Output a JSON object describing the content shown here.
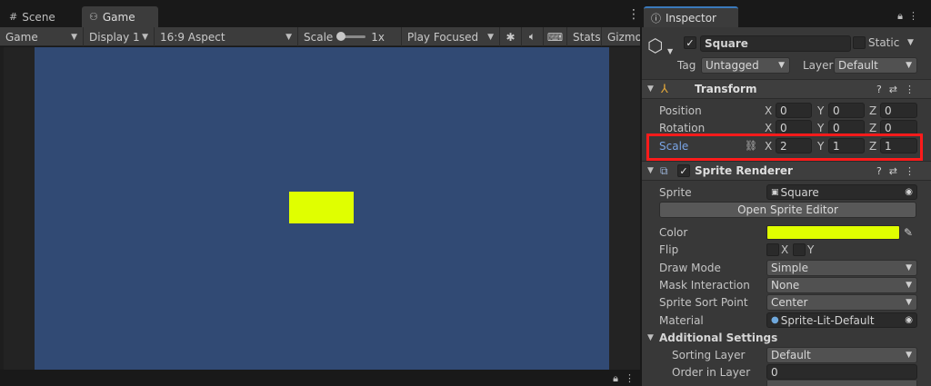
{
  "left": {
    "tabs": [
      {
        "label": "Scene",
        "icon": "grid-icon"
      },
      {
        "label": "Game",
        "icon": "gamepad-icon"
      }
    ],
    "toolbar": {
      "display_mode": "Game",
      "display": "Display 1",
      "aspect": "16:9 Aspect",
      "scale_label": "Scale",
      "scale_value": "1x",
      "play_mode": "Play Focused",
      "stats": "Stats",
      "gizmos": "Gizmos"
    },
    "scene_colors": {
      "background": "#314a74",
      "square": "#e0ff00"
    }
  },
  "inspector": {
    "tab_label": "Inspector",
    "object": {
      "name": "Square",
      "static_label": "Static",
      "tag_label": "Tag",
      "tag_value": "Untagged",
      "layer_label": "Layer",
      "layer_value": "Default"
    },
    "transform": {
      "title": "Transform",
      "position": {
        "label": "Position",
        "x": "0",
        "y": "0",
        "z": "0"
      },
      "rotation": {
        "label": "Rotation",
        "x": "0",
        "y": "0",
        "z": "0"
      },
      "scale": {
        "label": "Scale",
        "x": "2",
        "y": "1",
        "z": "1"
      },
      "axes": {
        "x": "X",
        "y": "Y",
        "z": "Z"
      }
    },
    "sprite_renderer": {
      "title": "Sprite Renderer",
      "sprite_label": "Sprite",
      "sprite_value": "Square",
      "open_editor": "Open Sprite Editor",
      "color_label": "Color",
      "color_value": "#e0ff00",
      "flip_label": "Flip",
      "flip_x": "X",
      "flip_y": "Y",
      "draw_mode_label": "Draw Mode",
      "draw_mode_value": "Simple",
      "mask_label": "Mask Interaction",
      "mask_value": "None",
      "sort_point_label": "Sprite Sort Point",
      "sort_point_value": "Center",
      "material_label": "Material",
      "material_value": "Sprite-Lit-Default",
      "additional_title": "Additional Settings",
      "sorting_layer_label": "Sorting Layer",
      "sorting_layer_value": "Default",
      "order_label": "Order in Layer",
      "order_value": "0"
    }
  }
}
